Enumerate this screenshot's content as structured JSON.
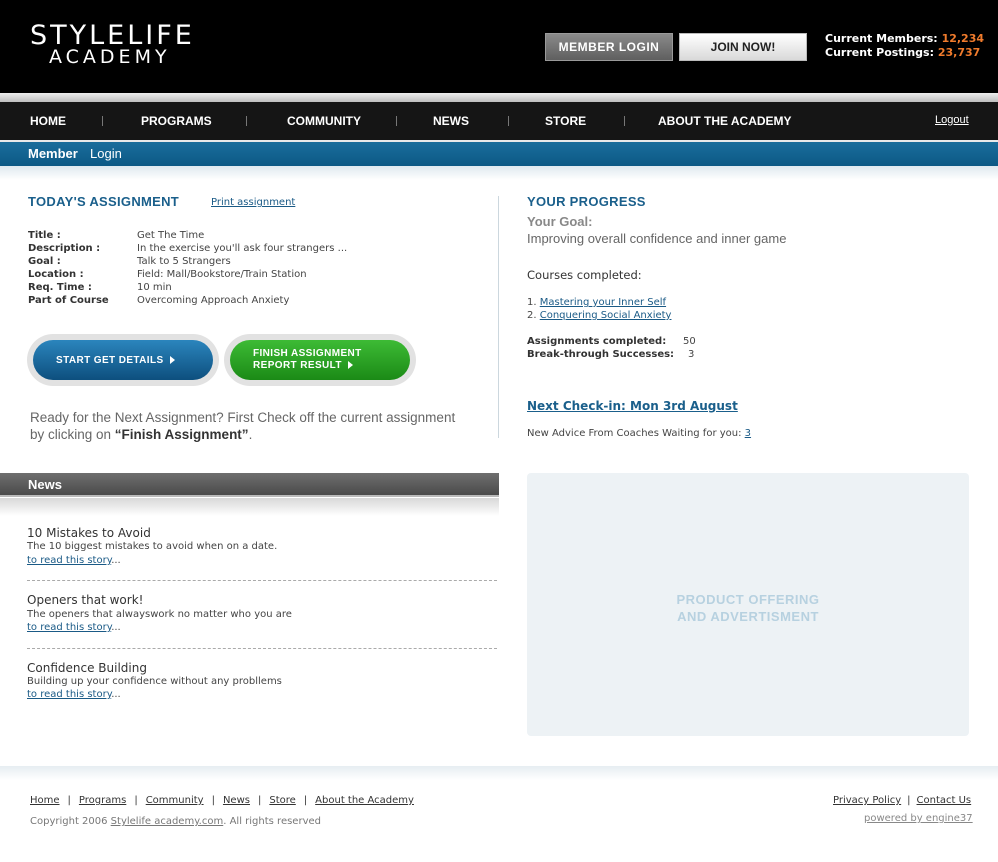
{
  "header": {
    "logo_line1": "STYLELIFE",
    "logo_line2": "ACADEMY",
    "member_login_label": "MEMBER  LOGIN",
    "join_label": "JOIN NOW!",
    "members_label": "Current Members:",
    "members_value": "12,234",
    "postings_label": "Current Postings:",
    "postings_value": "23,737",
    "accent_color": "#f07b2c"
  },
  "nav": {
    "items": [
      "HOME",
      "PROGRAMS",
      "COMMUNITY",
      "NEWS",
      "STORE",
      "ABOUT THE ACADEMY"
    ],
    "logout": "Logout"
  },
  "member_bar": {
    "bold": "Member",
    "regular": "Login",
    "color": "#1a6d9c"
  },
  "assignment": {
    "title": "TODAY'S ASSIGNMENT",
    "print_link": "Print assignment",
    "details": [
      {
        "label": "Title :",
        "value": "Get The Time"
      },
      {
        "label": "Description :",
        "value": "In the exercise you'll ask four strangers ..."
      },
      {
        "label": "Goal :",
        "value": "Talk to 5 Strangers"
      },
      {
        "label": "Location :",
        "value": "Field: Mall/Bookstore/Train Station"
      },
      {
        "label": "Req. Time :",
        "value": "10 min"
      },
      {
        "label": "Part of Course",
        "value": "Overcoming Approach Anxiety"
      }
    ],
    "start_button": "START GET DETAILS",
    "finish_button_line1": "FINISH ASSIGNMENT",
    "finish_button_line2": "REPORT RESULT",
    "ready_line1": "Ready for the Next Assignment? First Check off the current assignment",
    "ready_line2_pre": "by clicking on ",
    "ready_line2_bold": "“Finish Assignment”",
    "ready_line2_post": "."
  },
  "progress": {
    "title": "YOUR PROGRESS",
    "goal_label": "Your Goal:",
    "goal_text": "Improving overall confidence and inner game",
    "courses_label": "Courses completed:",
    "courses": [
      {
        "num": "1.",
        "name": "Mastering your Inner Self"
      },
      {
        "num": "2.",
        "name": "Conquering Social Anxiety"
      }
    ],
    "assignments_label": "Assignments completed:",
    "assignments_value": "50",
    "breakthrough_label": "Break-through Successes:",
    "breakthrough_value": "3",
    "checkin": "Next Check-in: Mon 3rd August",
    "advice_text": "New Advice From Coaches Waiting for you:",
    "advice_count": "3"
  },
  "news": {
    "header": "News",
    "items": [
      {
        "title": "10 Mistakes to Avoid",
        "desc": "The 10 biggest mistakes to avoid when on a date.",
        "link": "to read this story",
        "suffix": "..."
      },
      {
        "title": "Openers that work!",
        "desc": "The openers that alwayswork no matter who you are",
        "link": "to read this story",
        "suffix": "..."
      },
      {
        "title": "Confidence Building",
        "desc": "Building up your confidence without any probllems",
        "link": "to read this story",
        "suffix": "..."
      }
    ]
  },
  "ad": {
    "line1": "PRODUCT OFFERING",
    "line2": "AND ADVERTISMENT"
  },
  "footer": {
    "links": [
      "Home",
      "Programs",
      "Community",
      "News",
      "Store",
      "About the Academy"
    ],
    "copyright_pre": "Copyright 2006 ",
    "copyright_link": "Stylelife academy.com",
    "copyright_post": ".   All rights reserved",
    "right_links": [
      "Privacy Policy",
      "Contact Us"
    ],
    "powered": "powered by engine37"
  }
}
